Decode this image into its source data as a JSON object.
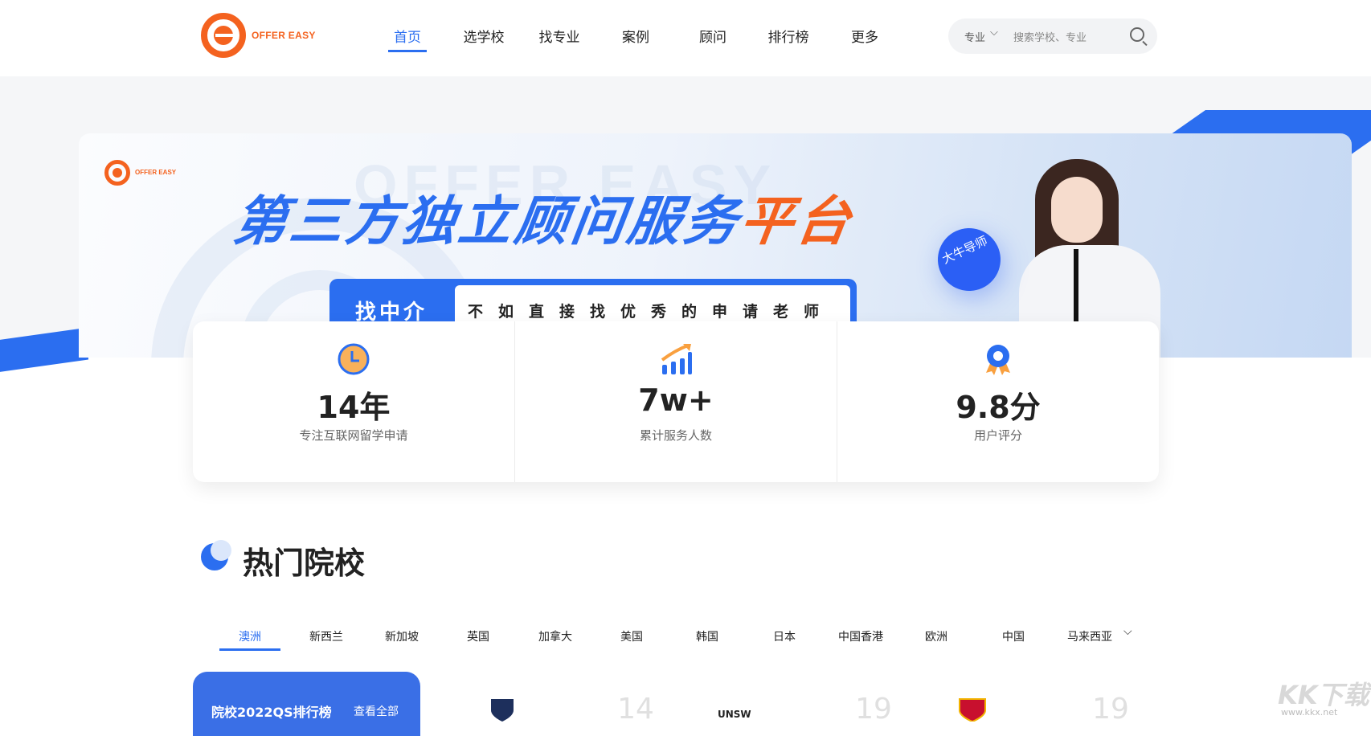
{
  "header": {
    "logo_text": "OFFER EASY",
    "nav": [
      "首页",
      "选学校",
      "找专业",
      "案例",
      "顾问",
      "排行榜",
      "更多"
    ],
    "active_nav": "首页",
    "search": {
      "category": "专业",
      "placeholder": "搜索学校、专业"
    }
  },
  "banner": {
    "logo_text": "OFFER EASY",
    "slogan_main": "第三方独立顾问服务",
    "slogan_highlight": "平台",
    "find_label": "找中介",
    "find_text": "不如直接找优秀的申请老师",
    "badge": "大牛导师"
  },
  "stats": [
    {
      "icon": "clock-icon",
      "value": "14年",
      "label": "专注互联网留学申请"
    },
    {
      "icon": "growth-chart-icon",
      "value": "7w+",
      "label": "累计服务人数"
    },
    {
      "icon": "award-ribbon-icon",
      "value": "9.8分",
      "label": "用户评分"
    }
  ],
  "hot_schools": {
    "title": "热门院校",
    "tabs": [
      "澳洲",
      "新西兰",
      "新加坡",
      "英国",
      "加拿大",
      "美国",
      "韩国",
      "日本",
      "中国香港",
      "欧洲",
      "中国",
      "马来西亚"
    ],
    "active_tab": "澳洲",
    "rank_card": {
      "title": "院校2022QS排行榜",
      "view_all": "查看全部"
    },
    "schools": [
      {
        "logo": "crest-logo",
        "rank": "14"
      },
      {
        "logo": "unsw-logo",
        "logo_text": "UNSW",
        "rank": "19"
      },
      {
        "logo": "lion-crest-logo",
        "rank": "19"
      }
    ]
  },
  "watermark": {
    "text": "KK下载",
    "url": "www.kkx.net"
  },
  "colors": {
    "brand_blue": "#2b6ef0",
    "brand_orange": "#f4621f"
  }
}
